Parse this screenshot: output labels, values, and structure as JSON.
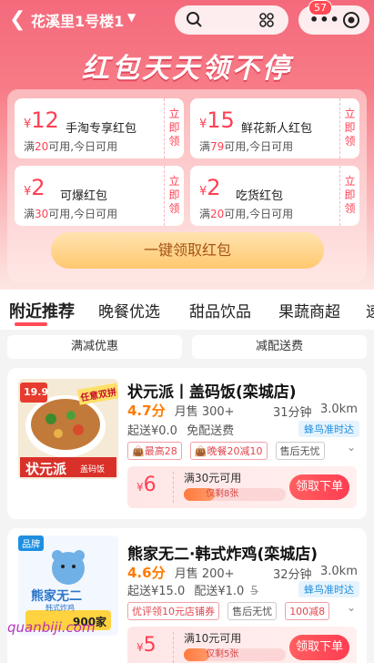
{
  "topbar": {
    "location": "花溪里1号楼1",
    "badge_count": "57"
  },
  "hero": {
    "title": "红包天天领不停",
    "claim_all": "一键领取红包"
  },
  "coupons": [
    {
      "symbol": "¥",
      "amount": "12",
      "name": "手淘专享红包",
      "cond_prefix": "满",
      "cond_value": "20",
      "cond_suffix": "可用,今日可用",
      "claim": "立即领"
    },
    {
      "symbol": "¥",
      "amount": "15",
      "name": "鲜花新人红包",
      "cond_prefix": "满",
      "cond_value": "79",
      "cond_suffix": "可用,今日可用",
      "claim": "立即领"
    },
    {
      "symbol": "¥",
      "amount": "2",
      "name": "可爆红包",
      "cond_prefix": "满",
      "cond_value": "30",
      "cond_suffix": "可用,今日可用",
      "claim": "立即领"
    },
    {
      "symbol": "¥",
      "amount": "2",
      "name": "吃货红包",
      "cond_prefix": "满",
      "cond_value": "20",
      "cond_suffix": "可用,今日可用",
      "claim": "立即领"
    }
  ],
  "tabs": [
    "附近推荐",
    "晚餐优选",
    "甜品饮品",
    "果蔬商超",
    "速"
  ],
  "chips": [
    "满减优惠",
    "减配送费"
  ],
  "stores": [
    {
      "name": "状元派丨盖码饭(栾城店)",
      "rating": "4.7分",
      "sales": "月售 300+",
      "time": "31分钟",
      "distance": "3.0km",
      "min_order": "起送¥0.0",
      "delivery": "免配送费",
      "fengniao": "蜂鸟准时达",
      "tags": [
        "最高28",
        "晚餐20减10",
        "售后无忧"
      ],
      "deal_symbol": "¥",
      "deal_amount": "6",
      "deal_cond": "满30元可用",
      "deal_left": "仅剩8张",
      "deal_btn": "领取下单",
      "thumb_text_top": "19.9",
      "thumb_text_stamp": "任意双拼",
      "thumb_text_brand": "状元派",
      "thumb_text_sub": "盖码饭"
    },
    {
      "name": "熊家无二·韩式炸鸡(栾城店)",
      "rating": "4.6分",
      "sales": "月售 200+",
      "time": "32分钟",
      "distance": "3.0km",
      "min_order": "起送¥15.0",
      "delivery": "配送¥1.0",
      "delivery_old": "5",
      "fengniao": "蜂鸟准时达",
      "tags": [
        "优评领10元店铺券",
        "售后无忧",
        "100减8"
      ],
      "deal_symbol": "¥",
      "deal_amount": "5",
      "deal_cond": "满10元可用",
      "deal_left": "仅剩5张",
      "deal_btn": "领取下单",
      "brand_label": "品牌",
      "thumb_text_brand": "熊家无二",
      "thumb_text_sub": "韩式炸鸡",
      "thumb_text_bottom": "900家"
    }
  ],
  "watermark": "quanbiji.com",
  "colors": {
    "accent": "#ff3f52",
    "hero_top": "#f46a7c",
    "rating": "#ff7a00",
    "fengniao": "#1e8fe0"
  },
  "progress": {
    "store0_remaining_fraction": 0.3,
    "store1_remaining_fraction": 0.25
  }
}
